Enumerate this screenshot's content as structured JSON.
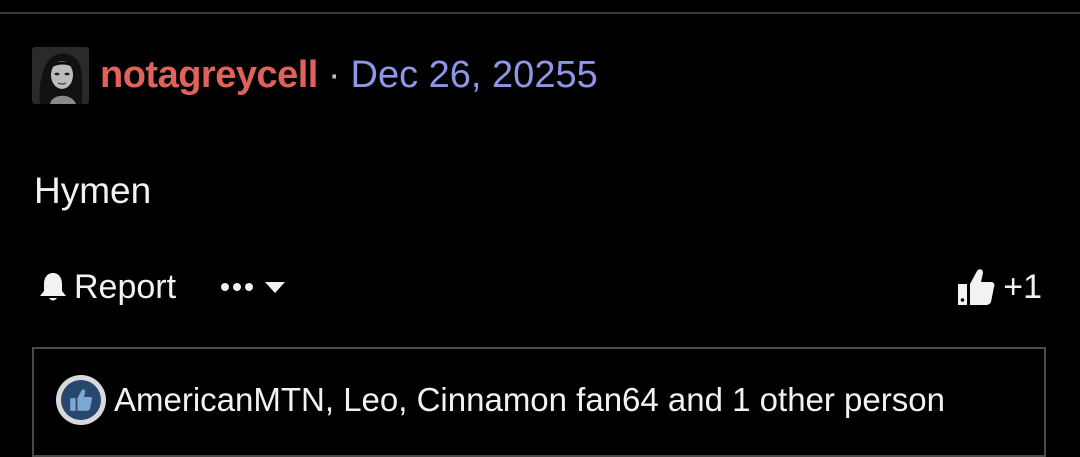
{
  "post": {
    "author": "notagreycell",
    "separator": "·",
    "date": "Dec 26, 20255",
    "content": "Hymen"
  },
  "actions": {
    "report_label": "Report",
    "like_count": "+1"
  },
  "reactions": {
    "summary": "AmericanMTN, Leo, Cinnamon fan64 and 1 other person"
  },
  "colors": {
    "background": "#000000",
    "username": "#e0625a",
    "date": "#8e97e6",
    "text": "#f2f2f2",
    "reaction_badge": "#27476e"
  },
  "icons": {
    "avatar": "avatar",
    "report": "bell-icon",
    "more": "ellipsis-icon",
    "dropdown": "caret-down-icon",
    "like": "thumbs-up-icon",
    "reaction": "thumbs-up-badge-icon"
  }
}
